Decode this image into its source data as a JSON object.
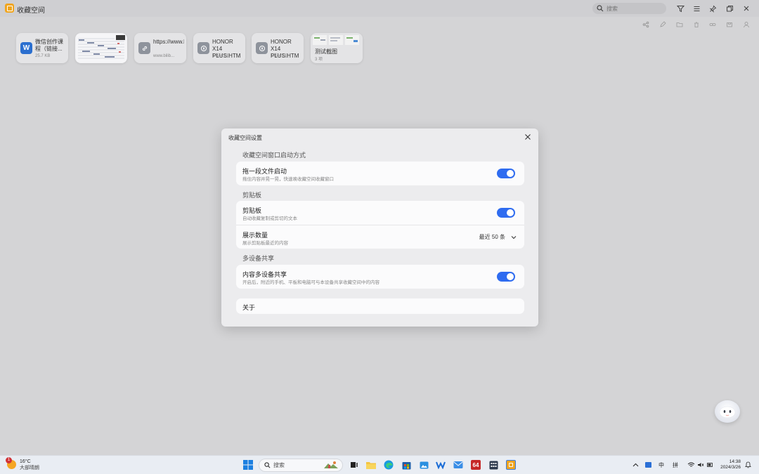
{
  "app": {
    "title": "收藏空间",
    "search_placeholder": "搜索"
  },
  "titlebar_icons": [
    "filter-icon",
    "menu-icon",
    "pin-icon",
    "restore-icon",
    "close-icon"
  ],
  "toolbar_icons": [
    "share-icon",
    "edit-icon",
    "folder-icon",
    "delete-icon",
    "link-icon",
    "save-icon",
    "user-icon"
  ],
  "cards": [
    {
      "type": "word",
      "title": "微信创作课程（链接...",
      "sub": "25.7 KB",
      "color": "#2b6fcf",
      "glyph": "W"
    },
    {
      "type": "image-thumb"
    },
    {
      "type": "link",
      "title": "https://www.bilibili",
      "sub": "www.bilib...",
      "color": "#8e939c"
    },
    {
      "type": "file",
      "title": "HONOR X14 PLUS.HTM",
      "sub": "175.4 KB",
      "color": "#8e939c"
    },
    {
      "type": "file",
      "title": "HONOR X14 PLUS.HTM",
      "sub": "175.4 KB",
      "color": "#8e939c"
    },
    {
      "type": "group",
      "title": "测试截图",
      "sub": "3 项"
    }
  ],
  "dialog": {
    "title": "收藏空间设置",
    "sections": [
      {
        "label": "收藏空间窗口启动方式",
        "rows": [
          {
            "title": "拖一段文件启动",
            "desc": "拖住内容并晃一晃，快速唤收藏空间收藏窗口",
            "control": "toggle",
            "on": true
          }
        ]
      },
      {
        "label": "剪贴板",
        "rows": [
          {
            "title": "剪贴板",
            "desc": "自动收藏复制或剪切的文本",
            "control": "toggle",
            "on": true
          },
          {
            "title": "展示数量",
            "desc": "展示剪贴板最近的内容",
            "control": "select",
            "value": "最近 50 条"
          }
        ]
      },
      {
        "label": "多设备共享",
        "rows": [
          {
            "title": "内容多设备共享",
            "desc": "开启后，附近的手机、平板和电脑可与本设备共享收藏空间中的内容",
            "control": "toggle",
            "on": true
          }
        ]
      }
    ],
    "about": "关于"
  },
  "taskbar": {
    "weather": {
      "temp": "16°C",
      "desc": "大部晴朗",
      "badge": "1"
    },
    "search_text": "搜索",
    "apps": [
      "start-icon",
      "task-view-icon",
      "file-explorer-icon",
      "edge-icon",
      "store-icon",
      "photos-icon",
      "wps-icon",
      "mail-icon",
      "aida64-icon",
      "calculator-icon",
      "collection-space-icon"
    ],
    "tray": {
      "lang": "中",
      "ime": "拼"
    },
    "clock": {
      "time": "14:38",
      "date": "2024/3/26"
    }
  },
  "colors": {
    "accent": "#2f6cf0",
    "background": "#d4d4d6",
    "dialog": "#ececee"
  }
}
